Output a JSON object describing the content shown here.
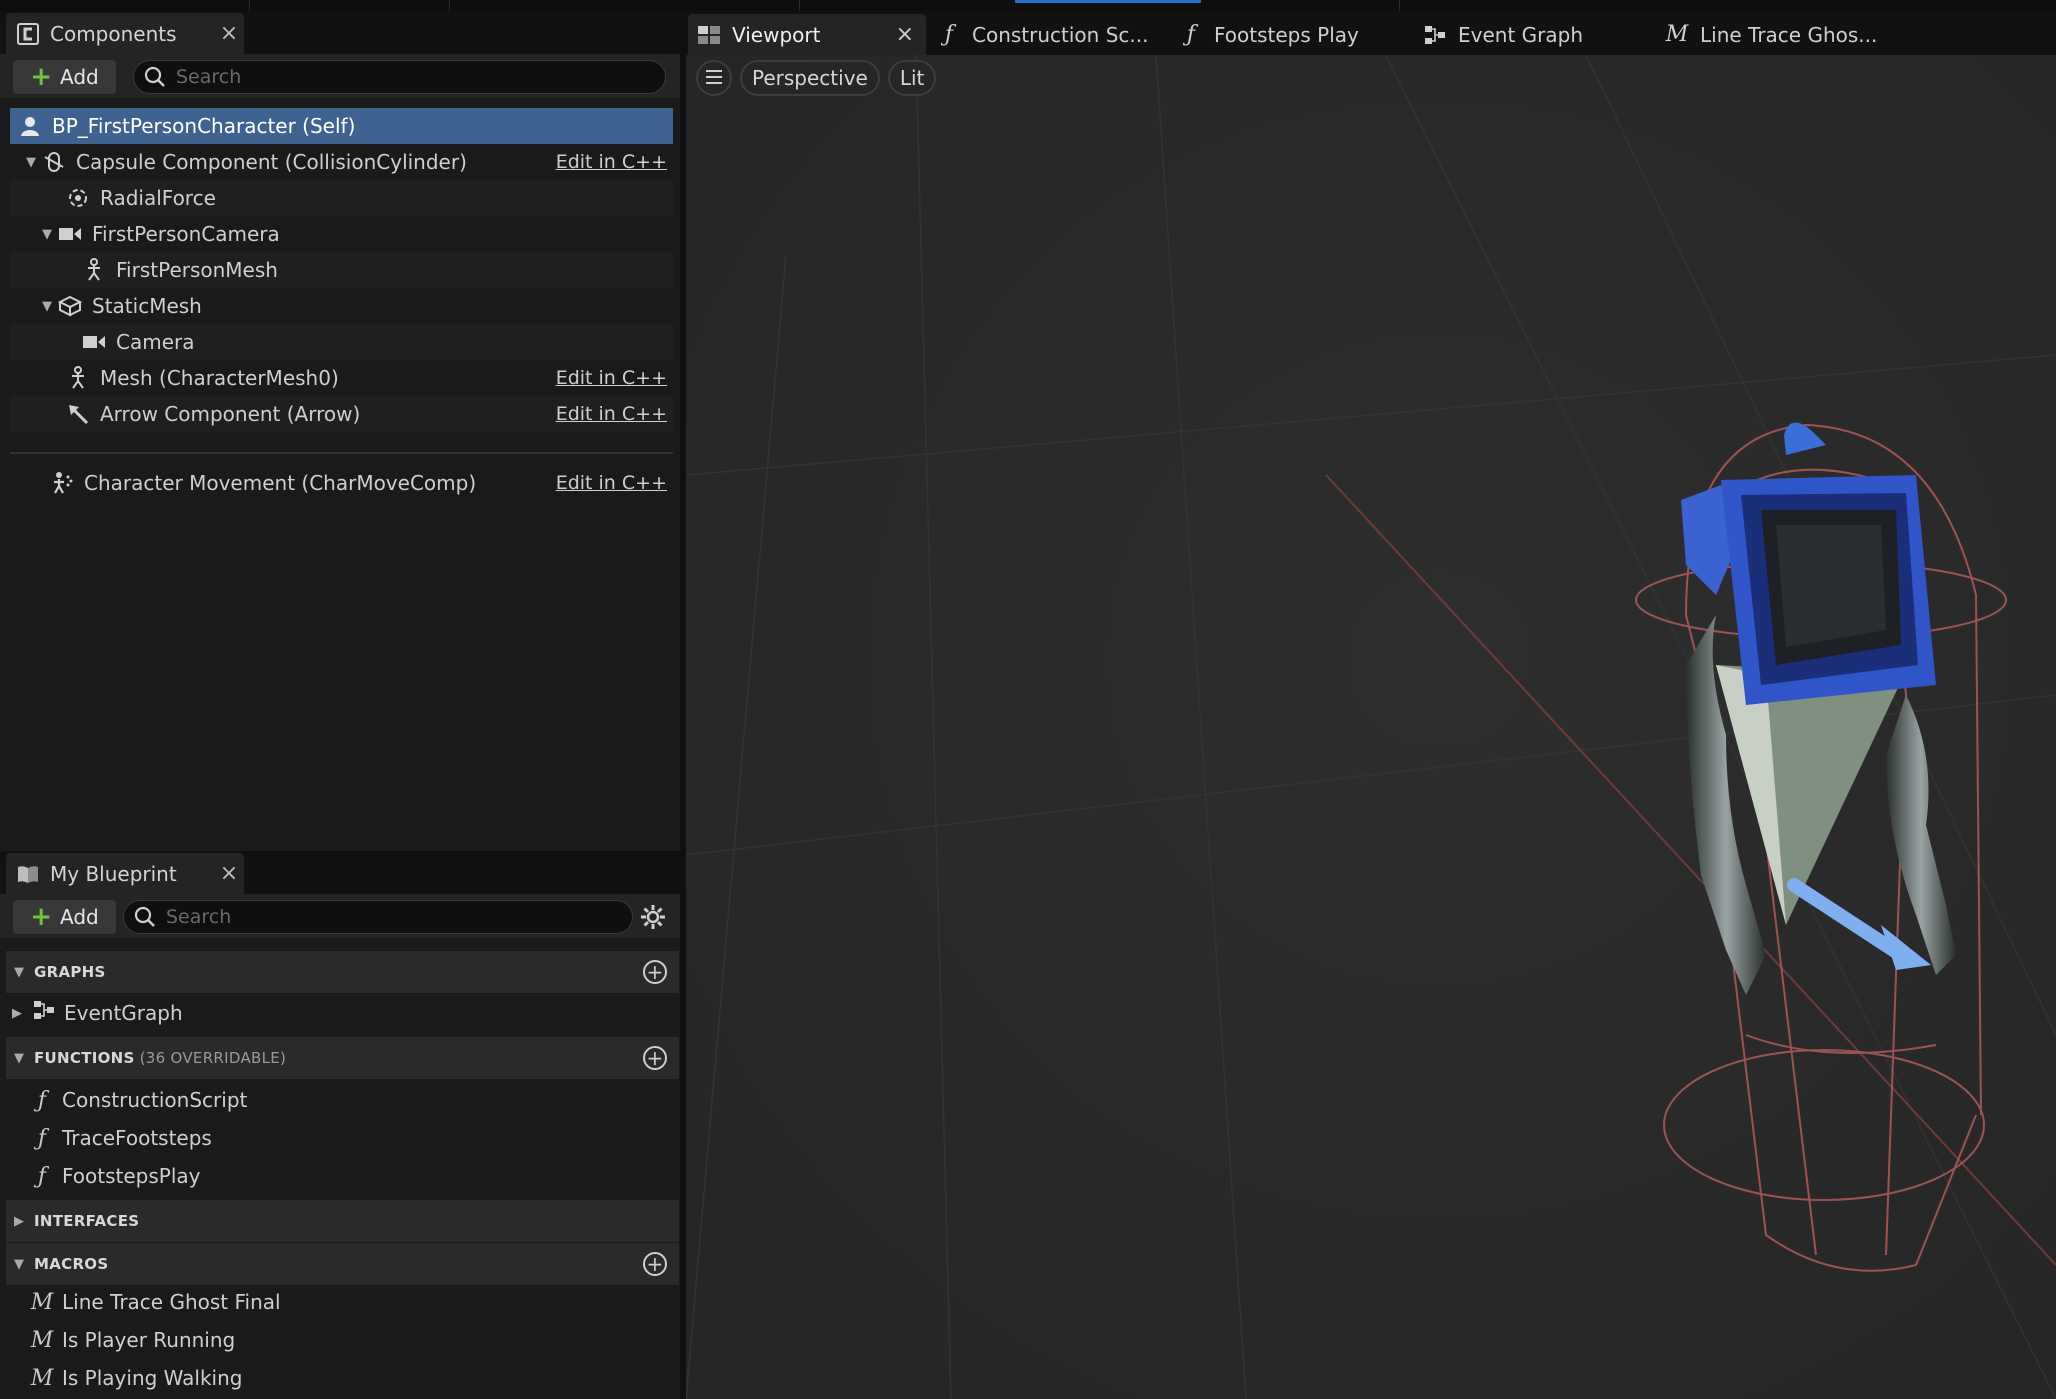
{
  "components": {
    "tab_label": "Components",
    "add_label": "Add",
    "search_placeholder": "Search",
    "edit_cpp_label": "Edit in C++",
    "root": "BP_FirstPersonCharacter (Self)",
    "items": [
      {
        "label": "Capsule Component (CollisionCylinder)",
        "icon": "capsule-icon",
        "editable": true
      },
      {
        "label": "RadialForce",
        "icon": "radial-force-icon",
        "editable": false
      },
      {
        "label": "FirstPersonCamera",
        "icon": "camera-icon",
        "editable": false
      },
      {
        "label": "FirstPersonMesh",
        "icon": "skeletal-mesh-icon",
        "editable": false
      },
      {
        "label": "StaticMesh",
        "icon": "static-mesh-icon",
        "editable": false
      },
      {
        "label": "Camera",
        "icon": "camera-icon",
        "editable": false
      },
      {
        "label": "Mesh (CharacterMesh0)",
        "icon": "skeletal-mesh-icon",
        "editable": true
      },
      {
        "label": "Arrow Component (Arrow)",
        "icon": "arrow-icon",
        "editable": true
      },
      {
        "label": "Character Movement (CharMoveComp)",
        "icon": "character-movement-icon",
        "editable": true
      }
    ]
  },
  "my_blueprint": {
    "tab_label": "My Blueprint",
    "add_label": "Add",
    "search_placeholder": "Search",
    "sections": {
      "graphs": {
        "title": "GRAPHS",
        "items": [
          "EventGraph"
        ]
      },
      "functions": {
        "title": "FUNCTIONS",
        "subtitle": "(36 OVERRIDABLE)",
        "items": [
          "ConstructionScript",
          "TraceFootsteps",
          "FootstepsPlay"
        ]
      },
      "interfaces": {
        "title": "INTERFACES"
      },
      "macros": {
        "title": "MACROS",
        "items": [
          "Line Trace Ghost Final",
          "Is Player Running",
          "Is Playing Walking"
        ]
      }
    }
  },
  "viewport": {
    "tabs": [
      {
        "label": "Viewport",
        "icon": "viewport-icon"
      },
      {
        "label": "Construction Sc...",
        "icon": "function-icon"
      },
      {
        "label": "Footsteps Play",
        "icon": "function-icon"
      },
      {
        "label": "Event Graph",
        "icon": "event-graph-icon"
      },
      {
        "label": "Line Trace Ghos...",
        "icon": "macro-icon"
      }
    ],
    "perspective_label": "Perspective",
    "lit_label": "Lit"
  },
  "colors": {
    "selection": "#3f6391",
    "accent_green": "#6fc23d",
    "mesh_blue": "#2f55c9",
    "collision_red": "#b25a5a"
  }
}
